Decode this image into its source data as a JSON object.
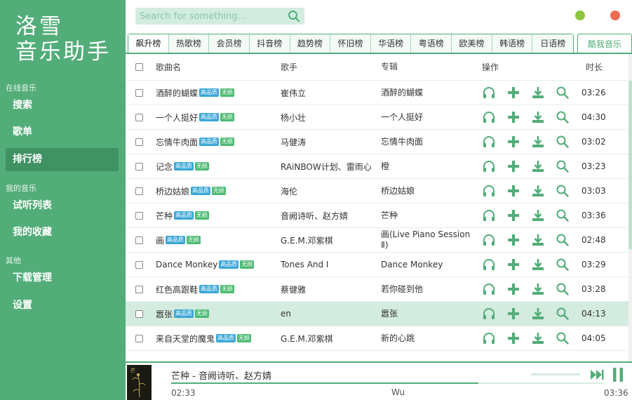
{
  "app": {
    "logo_line1": "洛雪",
    "logo_line2": "音乐助手"
  },
  "colors": {
    "accent": "#52ad78",
    "active_nav": "#3f9262",
    "hq_badge": "#3aa7d6",
    "lossless_badge": "#4cbb72",
    "min_dot": "#8cc63f",
    "close_dot": "#ed6c52"
  },
  "sidebar": {
    "sections": [
      {
        "title": "在线音乐",
        "items": [
          "搜索",
          "歌单",
          "排行榜"
        ]
      },
      {
        "title": "我的音乐",
        "items": [
          "试听列表",
          "我的收藏"
        ]
      },
      {
        "title": "其他",
        "items": [
          "下载管理",
          "设置"
        ]
      }
    ],
    "active_item": "排行榜"
  },
  "search": {
    "placeholder": "Search for something...",
    "icon": "search-icon"
  },
  "tabs": {
    "items": [
      "飙升榜",
      "热歌榜",
      "会员榜",
      "抖音榜",
      "趋势榜",
      "怀旧榜",
      "华语榜",
      "粤语榜",
      "欧美榜",
      "韩语榜",
      "日语榜"
    ],
    "active": "飙升榜",
    "fav": "酷我音乐"
  },
  "table": {
    "headers": {
      "name": "歌曲名",
      "singer": "歌手",
      "album": "专辑",
      "ops": "操作",
      "duration": "时长"
    },
    "badge_hq": "高品质",
    "badge_lossless": "无损",
    "op_icons": [
      "headphones-icon",
      "plus-icon",
      "download-icon",
      "search-icon"
    ],
    "highlighted_index": 9,
    "rows": [
      {
        "name": "酒醉的蝴蝶",
        "singer": "崔伟立",
        "album": "酒醉的蝴蝶",
        "duration": "03:26"
      },
      {
        "name": "一个人挺好",
        "singer": "杨小壮",
        "album": "一个人挺好",
        "duration": "04:30"
      },
      {
        "name": "忘情牛肉面",
        "singer": "马健涛",
        "album": "忘情牛肉面",
        "duration": "03:02"
      },
      {
        "name": "记念",
        "singer": "RAiNBOW计划、雷雨心",
        "album": "橙",
        "duration": "03:23"
      },
      {
        "name": "桥边姑娘",
        "singer": "海伦",
        "album": "桥边姑娘",
        "duration": "03:03"
      },
      {
        "name": "芒种",
        "singer": "音阙诗听、赵方婧",
        "album": "芒种",
        "duration": "03:36"
      },
      {
        "name": "画",
        "singer": "G.E.M.邓紫棋",
        "album": "画(Live Piano Session Ⅱ)",
        "duration": "02:48"
      },
      {
        "name": "Dance Monkey",
        "singer": "Tones And I",
        "album": "Dance Monkey",
        "duration": "03:29"
      },
      {
        "name": "红色高跟鞋",
        "singer": "蔡健雅",
        "album": "若你碰到他",
        "duration": "03:28"
      },
      {
        "name": "嚣张",
        "singer": "en",
        "album": "嚣张",
        "duration": "04:13"
      },
      {
        "name": "来自天堂的魔鬼",
        "singer": "G.E.M.邓紫棋",
        "album": "新的心跳",
        "duration": "04:05"
      }
    ]
  },
  "player": {
    "title": "芒种 - 音阙诗听、赵方婧",
    "current_time": "02:33",
    "total_time": "03:36",
    "lyric": "Wu",
    "progress": 0.71,
    "volume": 1.0
  }
}
